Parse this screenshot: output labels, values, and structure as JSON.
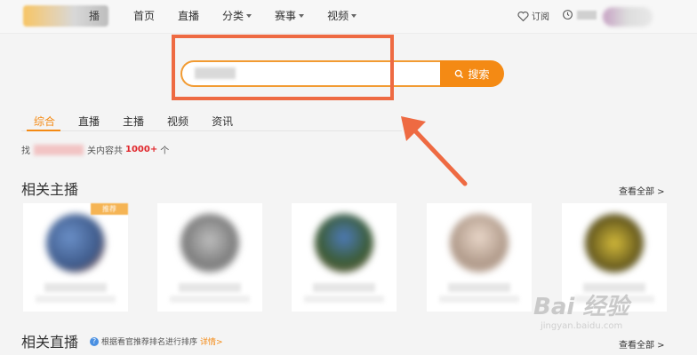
{
  "nav": {
    "logo_text": "播",
    "items": [
      {
        "label": "首页",
        "dropdown": false
      },
      {
        "label": "直播",
        "dropdown": false
      },
      {
        "label": "分类",
        "dropdown": true
      },
      {
        "label": "赛事",
        "dropdown": true
      },
      {
        "label": "视频",
        "dropdown": true
      }
    ],
    "subscribe_label": "订阅",
    "history_label": ""
  },
  "search": {
    "value": "■■■■",
    "button_label": "搜索"
  },
  "tabs": [
    {
      "label": "综合",
      "active": true
    },
    {
      "label": "直播",
      "active": false
    },
    {
      "label": "主播",
      "active": false
    },
    {
      "label": "视频",
      "active": false
    },
    {
      "label": "资讯",
      "active": false
    }
  ],
  "result": {
    "prefix": "找",
    "middle": "关内容共",
    "count": "1000+",
    "suffix": "个"
  },
  "sections": {
    "anchors_title": "相关主播",
    "anchors_see_all": "查看全部 >",
    "live_title": "相关直播",
    "live_see_all": "查看全部 >",
    "live_hint": "根据看官推荐排名进行排序",
    "live_hint_link": "详情>"
  },
  "cards": [
    {
      "badge": "推荐",
      "avatar_color": "#7d8fb5"
    },
    {
      "badge": "",
      "avatar_color": "#9a9a9a"
    },
    {
      "badge": "",
      "avatar_color": "#4f7a8c"
    },
    {
      "badge": "",
      "avatar_color": "#c9b8a8"
    },
    {
      "badge": "",
      "avatar_color": "#8c7a2e"
    }
  ],
  "watermark": {
    "main": "Bai 经验",
    "sub": "jingyan.baidu.com"
  },
  "colors": {
    "accent": "#f48a14",
    "annotation": "#ee6a42",
    "count": "#e0262b"
  }
}
